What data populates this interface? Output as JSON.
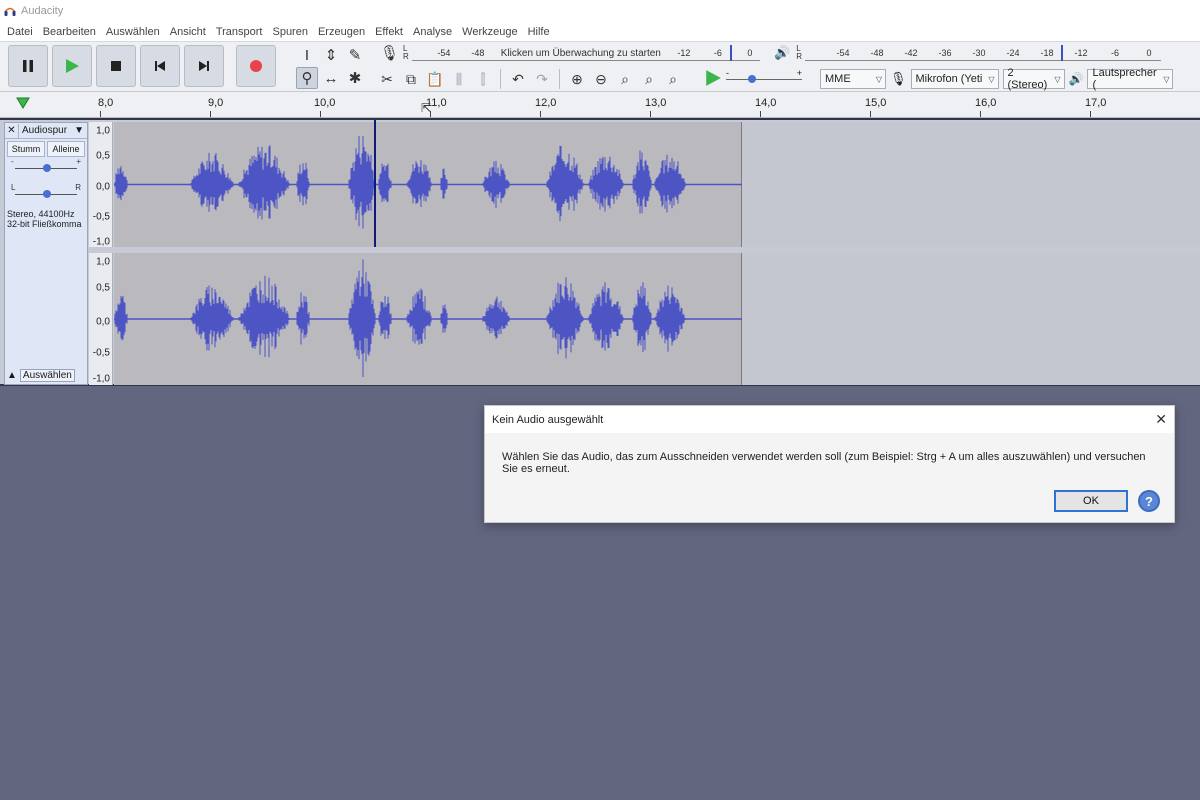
{
  "window": {
    "title": "Audacity"
  },
  "menu": [
    "Datei",
    "Bearbeiten",
    "Auswählen",
    "Ansicht",
    "Transport",
    "Spuren",
    "Erzeugen",
    "Effekt",
    "Analyse",
    "Werkzeuge",
    "Hilfe"
  ],
  "transport": {
    "pause_icon": "pause-icon",
    "play_icon": "play-icon",
    "stop_icon": "stop-icon",
    "skip_start_icon": "skip-to-start-icon",
    "skip_end_icon": "skip-to-end-icon",
    "record_icon": "record-icon",
    "record_color": "#e8434a",
    "play_color": "#3cb54a"
  },
  "recording_meter": {
    "lr_top": "L",
    "lr_bottom": "R",
    "ticks": [
      "-54",
      "-48",
      "-12",
      "-6",
      "0"
    ],
    "prompt": "Klicken um Überwachung zu starten"
  },
  "playback_meter": {
    "lr_top": "L",
    "lr_bottom": "R",
    "ticks": [
      "-54",
      "-48",
      "-42",
      "-36",
      "-30",
      "-24",
      "-18",
      "-12",
      "-6",
      "0"
    ]
  },
  "play_speed": {
    "minus": "-",
    "plus": "+",
    "level": 0.3
  },
  "devices": {
    "host": "MME",
    "microphone": "Mikrofon (Yeti S",
    "channels": "2 (Stereo)",
    "speaker": "Lautsprecher ("
  },
  "ruler": {
    "ticks": [
      "8,0",
      "9,0",
      "10,0",
      "11,0",
      "12,0",
      "13,0",
      "14,0",
      "15,0",
      "16,0",
      "17,0"
    ]
  },
  "track": {
    "name": "Audiospur",
    "mute": "Stumm",
    "solo": "Alleine",
    "gain_minus": "-",
    "gain_plus": "+",
    "pan_left": "L",
    "pan_right": "R",
    "info_line1": "Stereo, 44100Hz",
    "info_line2": "32-bit Fließkomma",
    "select_label": "Auswählen",
    "vruler_labels": [
      "1,0",
      "0,5",
      "0,0",
      "-0,5",
      "-1,0"
    ],
    "waveform_color": "#4d54c4"
  },
  "dialog": {
    "title": "Kein Audio ausgewählt",
    "message": "Wählen Sie das Audio, das zum Ausschneiden verwendet werden soll (zum Beispiel: Strg + A um alles auszuwählen) und versuchen Sie es erneut.",
    "ok_label": "OK",
    "help_label": "?"
  }
}
